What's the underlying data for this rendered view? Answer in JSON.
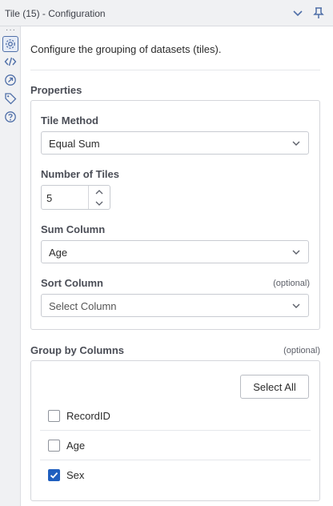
{
  "window": {
    "title": "Tile (15) - Configuration"
  },
  "rail": {
    "more": "···",
    "icons": [
      "gear-icon",
      "code-icon",
      "run-icon",
      "tag-icon",
      "help-icon"
    ]
  },
  "description": "Configure the grouping of datasets (tiles).",
  "properties": {
    "title": "Properties",
    "tile_method": {
      "label": "Tile Method",
      "value": "Equal Sum"
    },
    "number_of_tiles": {
      "label": "Number of Tiles",
      "value": "5"
    },
    "sum_column": {
      "label": "Sum Column",
      "value": "Age"
    },
    "sort_column": {
      "label": "Sort Column",
      "optional": "(optional)",
      "placeholder": "Select Column"
    }
  },
  "group_by": {
    "title": "Group by Columns",
    "optional": "(optional)",
    "select_all": "Select All",
    "columns": [
      {
        "name": "RecordID",
        "checked": false
      },
      {
        "name": "Age",
        "checked": false
      },
      {
        "name": "Sex",
        "checked": true
      }
    ]
  },
  "colors": {
    "accent": "#1f5fbf",
    "icon": "#4f6fa8"
  }
}
